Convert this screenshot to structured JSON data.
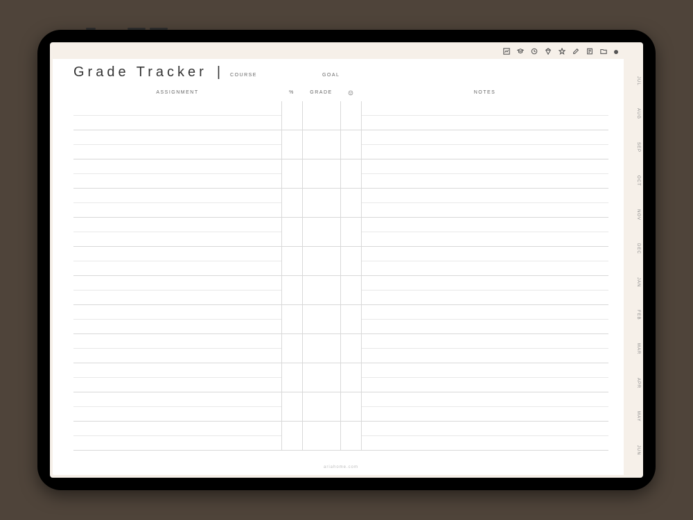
{
  "title": "Grade Tracker",
  "header": {
    "course_label": "COURSE",
    "goal_label": "GOAL"
  },
  "columns": {
    "assignment": "ASSIGNMENT",
    "percent": "%",
    "grade": "GRADE",
    "notes": "NOTES"
  },
  "footer": "ariahome.com",
  "toolbar_icons": [
    "chart",
    "education",
    "clock",
    "diamond",
    "star",
    "edit",
    "note",
    "folder",
    "dot"
  ],
  "months": [
    "JUL",
    "AUG",
    "SEP",
    "OCT",
    "NOV",
    "DEC",
    "JAN",
    "FEB",
    "MAR",
    "APR",
    "MAY",
    "JUN"
  ],
  "row_count": 12
}
